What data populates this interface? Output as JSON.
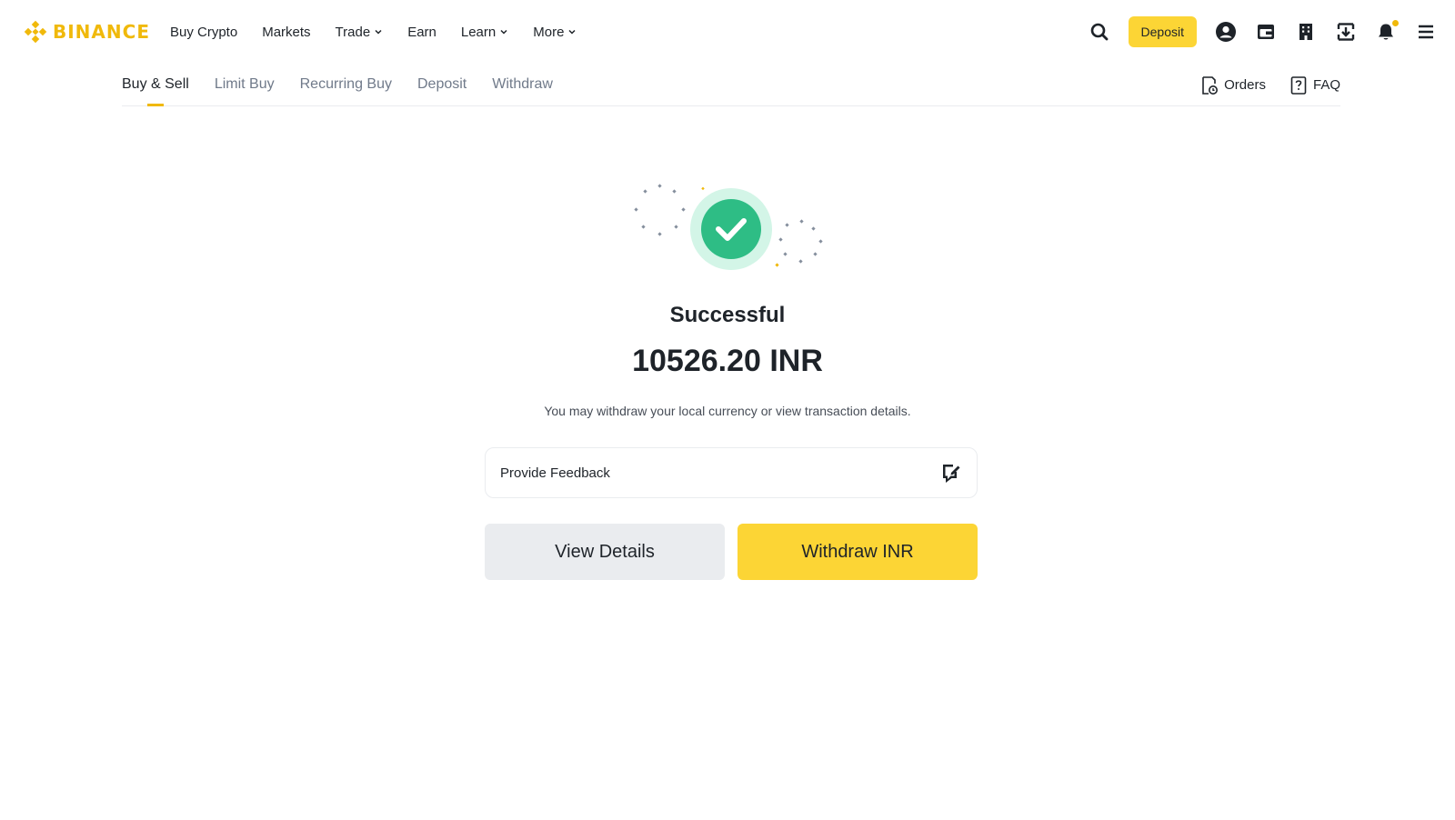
{
  "brand": {
    "name": "BINANCE",
    "color": "#f0b90b"
  },
  "nav": {
    "items": [
      {
        "label": "Buy Crypto",
        "dropdown": false
      },
      {
        "label": "Markets",
        "dropdown": false
      },
      {
        "label": "Trade",
        "dropdown": true
      },
      {
        "label": "Earn",
        "dropdown": false
      },
      {
        "label": "Learn",
        "dropdown": true
      },
      {
        "label": "More",
        "dropdown": true
      }
    ]
  },
  "header_actions": {
    "search_icon": "search-icon",
    "deposit_label": "Deposit",
    "icons": [
      "user-icon",
      "wallet-icon",
      "building-icon",
      "download-icon",
      "bell-icon",
      "menu-icon"
    ]
  },
  "subtabs": {
    "items": [
      "Buy & Sell",
      "Limit Buy",
      "Recurring Buy",
      "Deposit",
      "Withdraw"
    ],
    "active": "Buy & Sell",
    "orders_label": "Orders",
    "faq_label": "FAQ"
  },
  "result": {
    "status": "Successful",
    "amount": "10526.20 INR",
    "description": "You may withdraw your local currency or view transaction details.",
    "feedback_label": "Provide Feedback",
    "success_color": "#2ebd85"
  },
  "actions": {
    "view_details_label": "View Details",
    "withdraw_label": "Withdraw INR"
  },
  "colors": {
    "accent": "#fcd535",
    "text_primary": "#1e2329",
    "text_secondary": "#707a8a"
  }
}
